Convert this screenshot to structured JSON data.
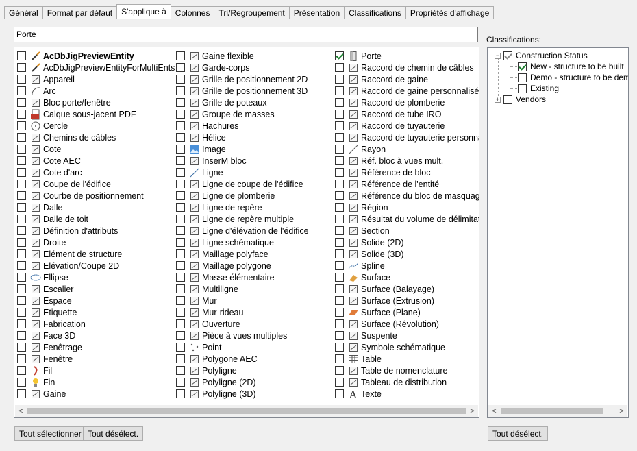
{
  "tabs": [
    {
      "label": "Général"
    },
    {
      "label": "Format par défaut"
    },
    {
      "label": "S'applique à"
    },
    {
      "label": "Colonnes"
    },
    {
      "label": "Tri/Regroupement"
    },
    {
      "label": "Présentation"
    },
    {
      "label": "Classifications"
    },
    {
      "label": "Propriétés d'affichage"
    }
  ],
  "active_tab": 2,
  "search": {
    "value": "Porte"
  },
  "columns": [
    [
      {
        "label": "AcDbJigPreviewEntity",
        "icon": "brush-icon",
        "checked": false,
        "bold": true
      },
      {
        "label": "AcDbJigPreviewEntityForMultiEnts",
        "icon": "brush-icon",
        "checked": false
      },
      {
        "label": "Appareil",
        "icon": "appliance-icon",
        "checked": false
      },
      {
        "label": "Arc",
        "icon": "arc-icon",
        "checked": false
      },
      {
        "label": "Bloc porte/fenêtre",
        "icon": "door-window-icon",
        "checked": false
      },
      {
        "label": "Calque sous-jacent PDF",
        "icon": "pdf-icon",
        "checked": false
      },
      {
        "label": "Cercle",
        "icon": "circle-icon",
        "checked": false
      },
      {
        "label": "Chemins de câbles",
        "icon": "cable-tray-icon",
        "checked": false
      },
      {
        "label": "Cote",
        "icon": "dimension-icon",
        "checked": false
      },
      {
        "label": "Cote AEC",
        "icon": "aec-dimension-icon",
        "checked": false
      },
      {
        "label": "Cote d'arc",
        "icon": "arc-dimension-icon",
        "checked": false
      },
      {
        "label": "Coupe de l'édifice",
        "icon": "building-section-icon",
        "checked": false
      },
      {
        "label": "Courbe de positionnement",
        "icon": "layout-curve-icon",
        "checked": false
      },
      {
        "label": "Dalle",
        "icon": "slab-icon",
        "checked": false
      },
      {
        "label": "Dalle de toit",
        "icon": "roof-slab-icon",
        "checked": false
      },
      {
        "label": "Définition d'attributs",
        "icon": "attribute-tag-icon",
        "checked": false
      },
      {
        "label": "Droite",
        "icon": "xline-icon",
        "checked": false
      },
      {
        "label": "Elément de structure",
        "icon": "structural-member-icon",
        "checked": false
      },
      {
        "label": "Elévation/Coupe 2D",
        "icon": "elevation-icon",
        "checked": false
      },
      {
        "label": "Ellipse",
        "icon": "ellipse-icon",
        "checked": false
      },
      {
        "label": "Escalier",
        "icon": "stair-icon",
        "checked": false
      },
      {
        "label": "Espace",
        "icon": "space-icon",
        "checked": false
      },
      {
        "label": "Etiquette",
        "icon": "label-icon",
        "checked": false
      },
      {
        "label": "Fabrication",
        "icon": "fabrication-icon",
        "checked": false
      },
      {
        "label": "Face 3D",
        "icon": "face3d-icon",
        "checked": false
      },
      {
        "label": "Fenêtrage",
        "icon": "window-assembly-icon",
        "checked": false
      },
      {
        "label": "Fenêtre",
        "icon": "window-icon",
        "checked": false
      },
      {
        "label": "Fil",
        "icon": "wire-icon",
        "checked": false
      },
      {
        "label": "Fin",
        "icon": "bulb-icon",
        "checked": false
      },
      {
        "label": "Gaine",
        "icon": "duct-icon",
        "checked": false
      }
    ],
    [
      {
        "label": "Gaine flexible",
        "icon": "flex-duct-icon",
        "checked": false
      },
      {
        "label": "Garde-corps",
        "icon": "railing-icon",
        "checked": false
      },
      {
        "label": "Grille de positionnement 2D",
        "icon": "grid2d-icon",
        "checked": false
      },
      {
        "label": "Grille de positionnement 3D",
        "icon": "grid3d-icon",
        "checked": false
      },
      {
        "label": "Grille de poteaux",
        "icon": "column-grid-icon",
        "checked": false
      },
      {
        "label": "Groupe de masses",
        "icon": "mass-group-icon",
        "checked": false
      },
      {
        "label": "Hachures",
        "icon": "hatch-icon",
        "checked": false
      },
      {
        "label": "Hélice",
        "icon": "helix-icon",
        "checked": false
      },
      {
        "label": "Image",
        "icon": "image-icon",
        "checked": false
      },
      {
        "label": "InserM bloc",
        "icon": "minsert-icon",
        "checked": false
      },
      {
        "label": "Ligne",
        "icon": "line-icon",
        "checked": false
      },
      {
        "label": "Ligne de coupe de l'édifice",
        "icon": "section-line-icon",
        "checked": false
      },
      {
        "label": "Ligne de plomberie",
        "icon": "plumbing-line-icon",
        "checked": false
      },
      {
        "label": "Ligne de repère",
        "icon": "leader-icon",
        "checked": false
      },
      {
        "label": "Ligne de repère multiple",
        "icon": "multileader-icon",
        "checked": false
      },
      {
        "label": "Ligne d'élévation de l'édifice",
        "icon": "elevation-line-icon",
        "checked": false
      },
      {
        "label": "Ligne schématique",
        "icon": "schematic-line-icon",
        "checked": false
      },
      {
        "label": "Maillage polyface",
        "icon": "polyface-icon",
        "checked": false
      },
      {
        "label": "Maillage polygone",
        "icon": "polygon-mesh-icon",
        "checked": false
      },
      {
        "label": "Masse élémentaire",
        "icon": "mass-element-icon",
        "checked": false
      },
      {
        "label": "Multiligne",
        "icon": "mline-icon",
        "checked": false
      },
      {
        "label": "Mur",
        "icon": "wall-icon",
        "checked": false
      },
      {
        "label": "Mur-rideau",
        "icon": "curtain-wall-icon",
        "checked": false
      },
      {
        "label": "Ouverture",
        "icon": "opening-icon",
        "checked": false
      },
      {
        "label": "Pièce à vues multiples",
        "icon": "mvpart-icon",
        "checked": false
      },
      {
        "label": "Point",
        "icon": "point-icon",
        "checked": false
      },
      {
        "label": "Polygone AEC",
        "icon": "aec-polygon-icon",
        "checked": false
      },
      {
        "label": "Polyligne",
        "icon": "polyline-icon",
        "checked": false
      },
      {
        "label": "Polyligne (2D)",
        "icon": "polyline2d-icon",
        "checked": false
      },
      {
        "label": "Polyligne (3D)",
        "icon": "polyline3d-icon",
        "checked": false
      }
    ],
    [
      {
        "label": "Porte",
        "icon": "door-icon",
        "checked": true
      },
      {
        "label": "Raccord de chemin de câbles",
        "icon": "cable-fitting-icon",
        "checked": false
      },
      {
        "label": "Raccord de gaine",
        "icon": "duct-fitting-icon",
        "checked": false
      },
      {
        "label": "Raccord de gaine personnalisé",
        "icon": "custom-duct-fitting-icon",
        "checked": false
      },
      {
        "label": "Raccord de plomberie",
        "icon": "plumbing-fitting-icon",
        "checked": false
      },
      {
        "label": "Raccord de tube IRO",
        "icon": "conduit-fitting-icon",
        "checked": false
      },
      {
        "label": "Raccord de tuyauterie",
        "icon": "pipe-fitting-icon",
        "checked": false
      },
      {
        "label": "Raccord de tuyauterie personnali",
        "icon": "custom-pipe-fitting-icon",
        "checked": false
      },
      {
        "label": "Rayon",
        "icon": "ray-icon",
        "checked": false
      },
      {
        "label": "Réf. bloc à vues mult.",
        "icon": "mvblock-icon",
        "checked": false
      },
      {
        "label": "Référence de bloc",
        "icon": "block-ref-icon",
        "checked": false
      },
      {
        "label": "Référence de l'entité",
        "icon": "entity-ref-icon",
        "checked": false
      },
      {
        "label": "Référence du bloc de masquage",
        "icon": "mask-block-icon",
        "checked": false
      },
      {
        "label": "Région",
        "icon": "region-icon",
        "checked": false
      },
      {
        "label": "Résultat du volume de délimitatio",
        "icon": "volume-icon",
        "checked": false
      },
      {
        "label": "Section",
        "icon": "section-icon",
        "checked": false
      },
      {
        "label": "Solide (2D)",
        "icon": "solid2d-icon",
        "checked": false
      },
      {
        "label": "Solide (3D)",
        "icon": "solid3d-icon",
        "checked": false
      },
      {
        "label": "Spline",
        "icon": "spline-icon",
        "checked": false
      },
      {
        "label": "Surface",
        "icon": "surface-icon",
        "checked": false
      },
      {
        "label": "Surface (Balayage)",
        "icon": "sweep-surface-icon",
        "checked": false
      },
      {
        "label": "Surface (Extrusion)",
        "icon": "extrude-surface-icon",
        "checked": false
      },
      {
        "label": "Surface (Plane)",
        "icon": "planar-surface-icon",
        "checked": false
      },
      {
        "label": "Surface (Révolution)",
        "icon": "revolve-surface-icon",
        "checked": false
      },
      {
        "label": "Suspente",
        "icon": "hanger-icon",
        "checked": false
      },
      {
        "label": "Symbole schématique",
        "icon": "schematic-symbol-icon",
        "checked": false
      },
      {
        "label": "Table",
        "icon": "table-icon",
        "checked": false
      },
      {
        "label": "Table de nomenclature",
        "icon": "schedule-table-icon",
        "checked": false
      },
      {
        "label": "Tableau de distribution",
        "icon": "panel-icon",
        "checked": false
      },
      {
        "label": "Texte",
        "icon": "text-icon",
        "checked": false
      }
    ]
  ],
  "classifications": {
    "label": "Classifications:",
    "tree": {
      "construction_status": {
        "label": "Construction Status",
        "expander": "−"
      },
      "new": {
        "label": "New - structure to be built",
        "checked": true
      },
      "demo": {
        "label": "Demo - structure to be demolis",
        "checked": false
      },
      "existing": {
        "label": "Existing",
        "checked": false
      },
      "vendors": {
        "label": "Vendors",
        "expander": "+"
      }
    }
  },
  "buttons": {
    "select_all": "Tout sélectionner",
    "deselect_all": "Tout désélect.",
    "deselect_all_right": "Tout désélect."
  },
  "scroll_arrows": {
    "left": "<",
    "right": ">"
  },
  "colors": {
    "accent": "#0078d7",
    "check_green": "#1a7f2e",
    "border": "#828790"
  }
}
